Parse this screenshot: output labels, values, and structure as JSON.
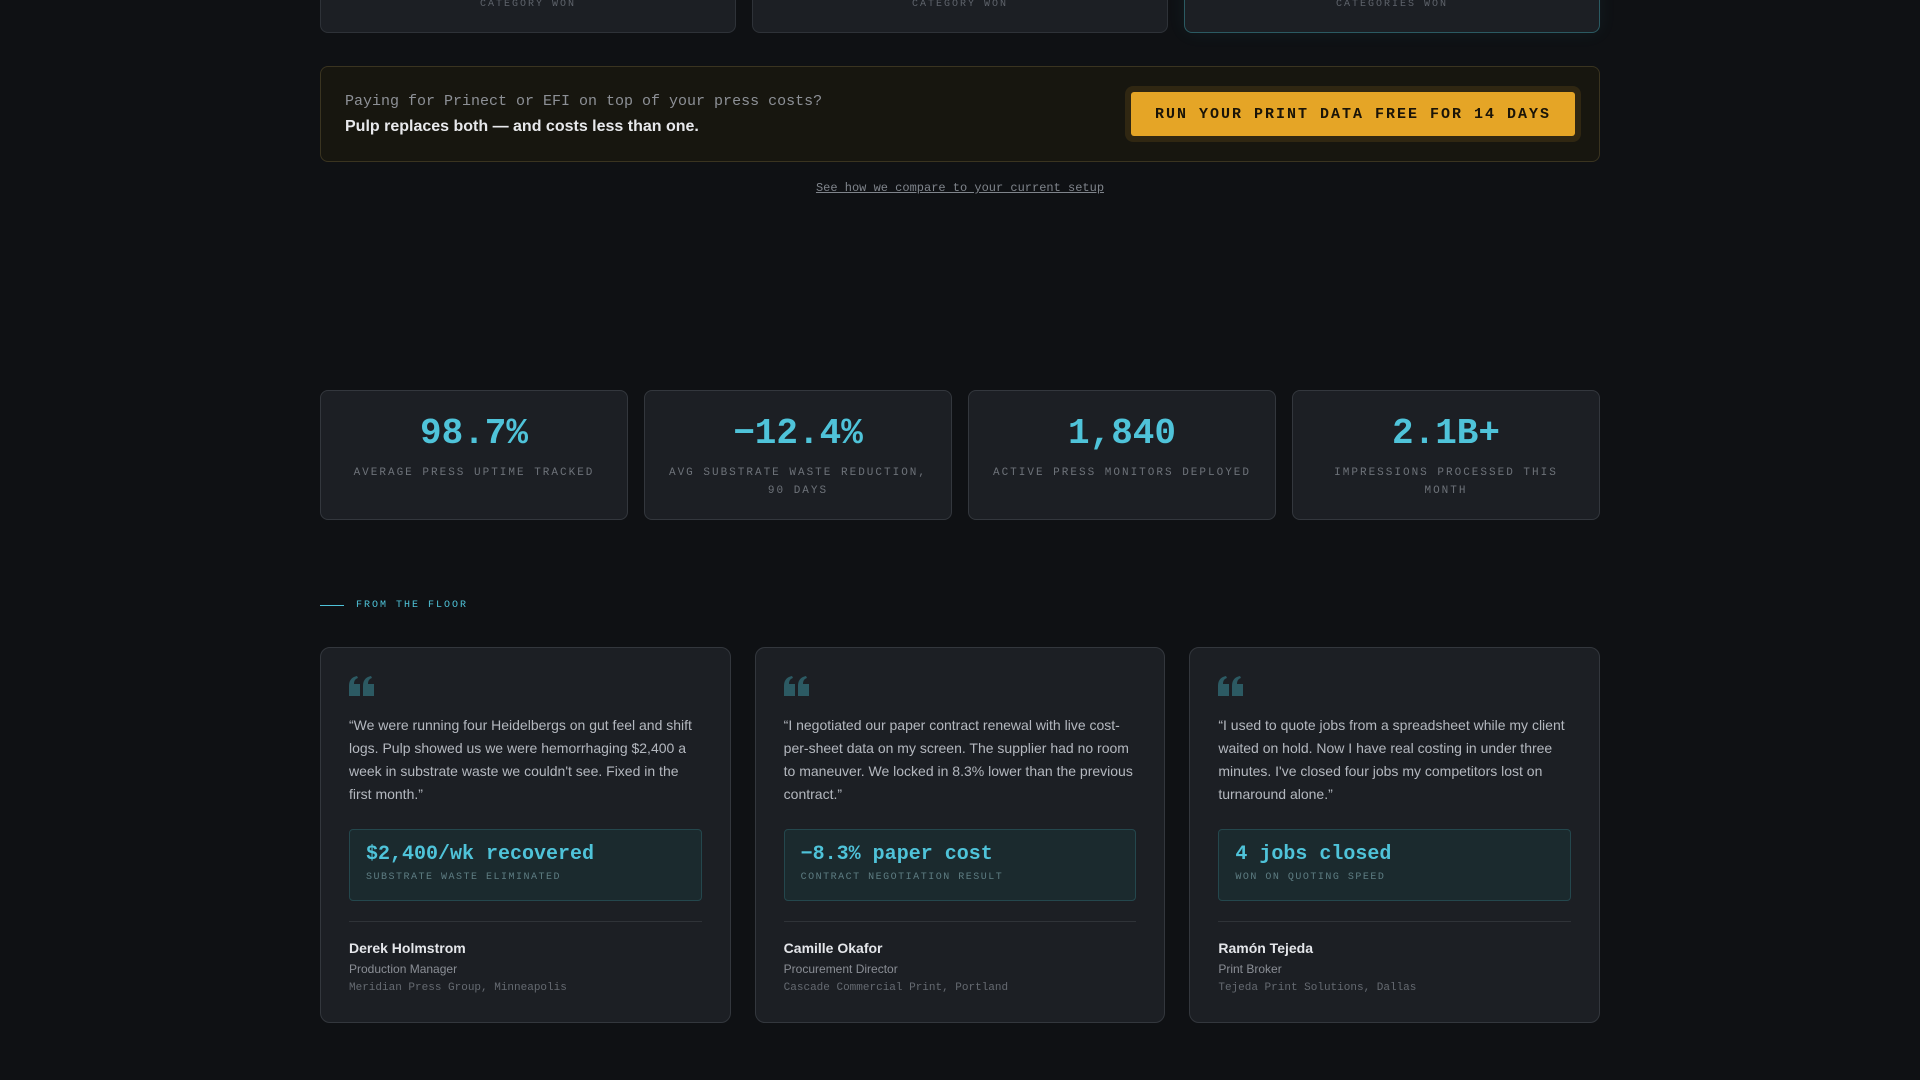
{
  "top_cards": [
    {
      "label": "CATEGORY WON"
    },
    {
      "label": "CATEGORY WON"
    },
    {
      "label": "CATEGORIES WON"
    }
  ],
  "cta": {
    "question": "Paying for Prinect or EFI on top of your press costs?",
    "statement": "Pulp replaces both — and costs less than one.",
    "button_label": "RUN YOUR PRINT DATA FREE FOR 14 DAYS",
    "compare_link": "See how we compare to your current setup"
  },
  "stats": [
    {
      "value": "98.7%",
      "label": "AVERAGE PRESS UPTIME TRACKED"
    },
    {
      "value": "−12.4%",
      "label": "AVG SUBSTRATE WASTE REDUCTION, 90 DAYS"
    },
    {
      "value": "1,840",
      "label": "ACTIVE PRESS MONITORS DEPLOYED"
    },
    {
      "value": "2.1B+",
      "label": "IMPRESSIONS PROCESSED THIS MONTH"
    }
  ],
  "section_label": "FROM THE FLOOR",
  "testimonials": [
    {
      "quote": "“We were running four Heidelbergs on gut feel and shift logs. Pulp showed us we were hemorrhaging $2,400 a week in substrate waste we couldn't see. Fixed in the first month.”",
      "metric_value": "$2,400/wk recovered",
      "metric_label": "SUBSTRATE WASTE ELIMINATED",
      "name": "Derek Holmstrom",
      "role": "Production Manager",
      "company": "Meridian Press Group, Minneapolis"
    },
    {
      "quote": "“I negotiated our paper contract renewal with live cost-per-sheet data on my screen. The supplier had no room to maneuver. We locked in 8.3% lower than the previous contract.”",
      "metric_value": "−8.3% paper cost",
      "metric_label": "CONTRACT NEGOTIATION RESULT",
      "name": "Camille Okafor",
      "role": "Procurement Director",
      "company": "Cascade Commercial Print, Portland"
    },
    {
      "quote": "“I used to quote jobs from a spreadsheet while my client waited on hold. Now I have real costing in under three minutes. I've closed four jobs my competitors lost on turnaround alone.”",
      "metric_value": "4 jobs closed",
      "metric_label": "WON ON QUOTING SPEED",
      "name": "Ramón Tejeda",
      "role": "Print Broker",
      "company": "Tejeda Print Solutions, Dallas"
    }
  ],
  "colors": {
    "accent": "#4fc3d9",
    "cta_button": "#e5a526",
    "background": "#0f1114",
    "card": "#1c1f24"
  },
  "icons": {
    "quote": "quote-mark-icon"
  }
}
